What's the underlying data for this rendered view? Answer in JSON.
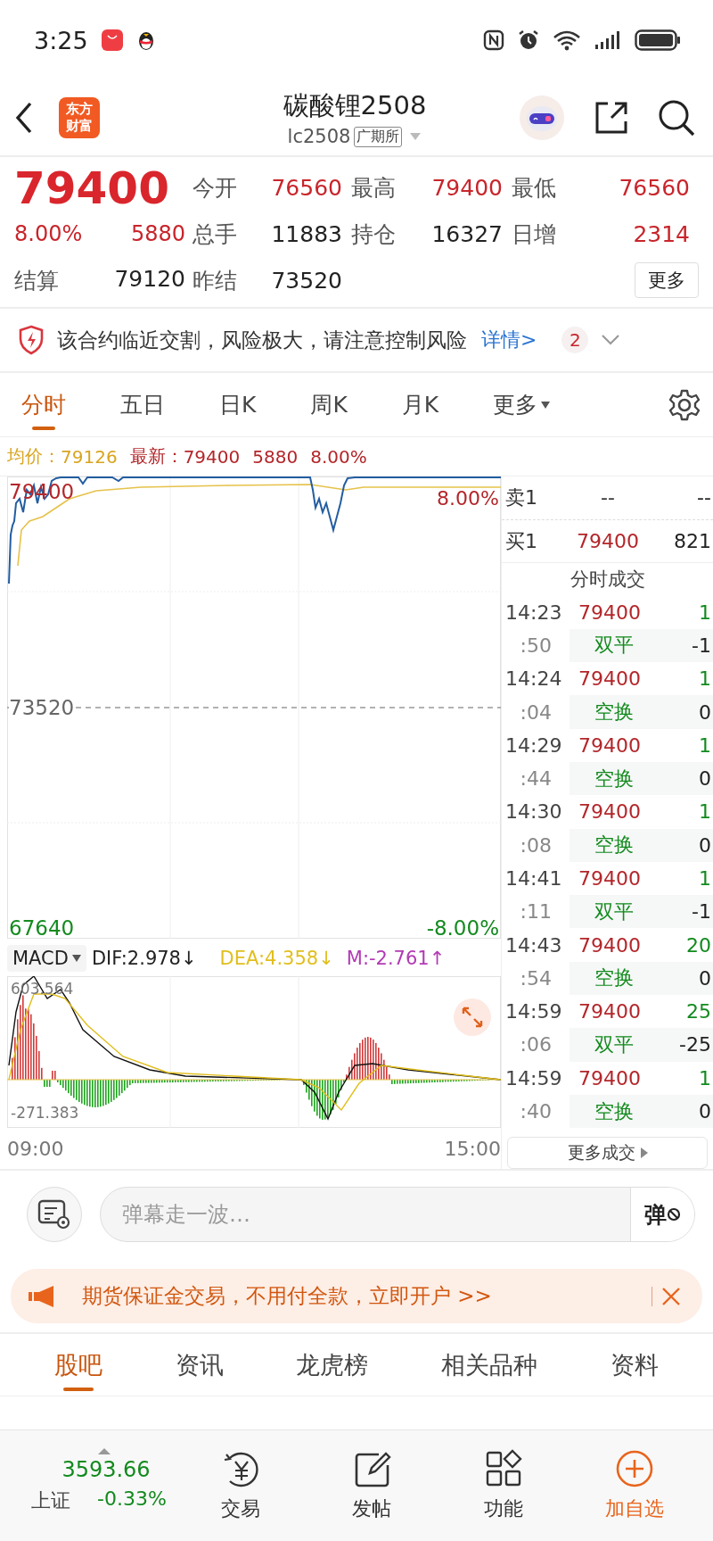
{
  "status_bar": {
    "time": "3:25"
  },
  "header": {
    "logo": "东方财富",
    "title": "碳酸锂2508",
    "code": "lc2508",
    "exchange": "广期所"
  },
  "quote": {
    "price": "79400",
    "change_pct": "8.00%",
    "change": "5880",
    "settle_label": "结算",
    "settle": "79120",
    "stats": [
      {
        "label": "今开",
        "value": "76560",
        "rising": true
      },
      {
        "label": "最高",
        "value": "79400",
        "rising": true
      },
      {
        "label": "最低",
        "value": "76560",
        "rising": true
      },
      {
        "label": "总手",
        "value": "11883",
        "rising": false
      },
      {
        "label": "持仓",
        "value": "16327",
        "rising": false
      },
      {
        "label": "日增",
        "value": "2314",
        "rising": true
      },
      {
        "label": "昨结",
        "value": "73520",
        "rising": false
      }
    ],
    "more_button": "更多"
  },
  "alert": {
    "text": "该合约临近交割，风险极大，请注意控制风险",
    "link": "详情>",
    "count": "2"
  },
  "chart_tabs": [
    {
      "label": "分时",
      "selected": true,
      "kind": "tab"
    },
    {
      "label": "五日",
      "selected": false,
      "kind": "tab"
    },
    {
      "label": "日K",
      "selected": false,
      "kind": "tab"
    },
    {
      "label": "周K",
      "selected": false,
      "kind": "tab"
    },
    {
      "label": "月K",
      "selected": false,
      "kind": "tab"
    },
    {
      "label": "更多",
      "selected": false,
      "kind": "menu"
    }
  ],
  "chart_info": {
    "avg_label": "均价：",
    "avg": "79126",
    "latest_label": "最新：",
    "latest": "79400",
    "change": "5880",
    "change_pct": "8.00%"
  },
  "price_chart": {
    "top_price": "79400",
    "top_pct": "8.00%",
    "mid_price": "73520",
    "bottom_price": "67640",
    "bottom_pct": "-8.00%"
  },
  "macd": {
    "selector": "MACD",
    "dif": "DIF:2.978↓",
    "dea": "DEA:4.358↓",
    "m": "M:-2.761↑",
    "max": "603.564",
    "min": "-271.383"
  },
  "time_axis": [
    "09:00",
    "15:00"
  ],
  "order_book": [
    {
      "side": "卖1",
      "price": "--",
      "volume": "--"
    },
    {
      "side": "买1",
      "price": "79400",
      "volume": "821"
    }
  ],
  "trades": {
    "title": "分时成交",
    "more_button": "更多成交",
    "rows": [
      {
        "kind": "trade",
        "time": "14:23",
        "price": "79400",
        "volume": "1"
      },
      {
        "kind": "sub",
        "time": ":50",
        "type": "双平",
        "volume": "-1"
      },
      {
        "kind": "trade",
        "time": "14:24",
        "price": "79400",
        "volume": "1"
      },
      {
        "kind": "sub",
        "time": ":04",
        "type": "空换",
        "volume": "0"
      },
      {
        "kind": "trade",
        "time": "14:29",
        "price": "79400",
        "volume": "1"
      },
      {
        "kind": "sub",
        "time": ":44",
        "type": "空换",
        "volume": "0"
      },
      {
        "kind": "trade",
        "time": "14:30",
        "price": "79400",
        "volume": "1"
      },
      {
        "kind": "sub",
        "time": ":08",
        "type": "空换",
        "volume": "0"
      },
      {
        "kind": "trade",
        "time": "14:41",
        "price": "79400",
        "volume": "1"
      },
      {
        "kind": "sub",
        "time": ":11",
        "type": "双平",
        "volume": "-1"
      },
      {
        "kind": "trade",
        "time": "14:43",
        "price": "79400",
        "volume": "20"
      },
      {
        "kind": "sub",
        "time": ":54",
        "type": "空换",
        "volume": "0"
      },
      {
        "kind": "trade",
        "time": "14:59",
        "price": "79400",
        "volume": "25"
      },
      {
        "kind": "sub",
        "time": ":06",
        "type": "双平",
        "volume": "-25"
      },
      {
        "kind": "trade",
        "time": "14:59",
        "price": "79400",
        "volume": "1"
      },
      {
        "kind": "sub",
        "time": ":40",
        "type": "空换",
        "volume": "0"
      }
    ]
  },
  "comment_bar": {
    "placeholder": "弹幕走一波…",
    "toggle": "弹"
  },
  "ad": {
    "text": "期货保证金交易，不用付全款，立即开户 >>"
  },
  "section_tabs": [
    {
      "label": "股吧",
      "selected": true
    },
    {
      "label": "资讯",
      "selected": false
    },
    {
      "label": "龙虎榜",
      "selected": false
    },
    {
      "label": "相关品种",
      "selected": false
    },
    {
      "label": "资料",
      "selected": false
    }
  ],
  "bottom_nav": {
    "index_value": "3593.66",
    "index_name": "上证",
    "index_change": "-0.33%",
    "items": [
      {
        "label": "交易",
        "kind": "trade"
      },
      {
        "label": "发帖",
        "kind": "post"
      },
      {
        "label": "功能",
        "kind": "apps"
      },
      {
        "label": "加自选",
        "kind": "add"
      }
    ]
  }
}
